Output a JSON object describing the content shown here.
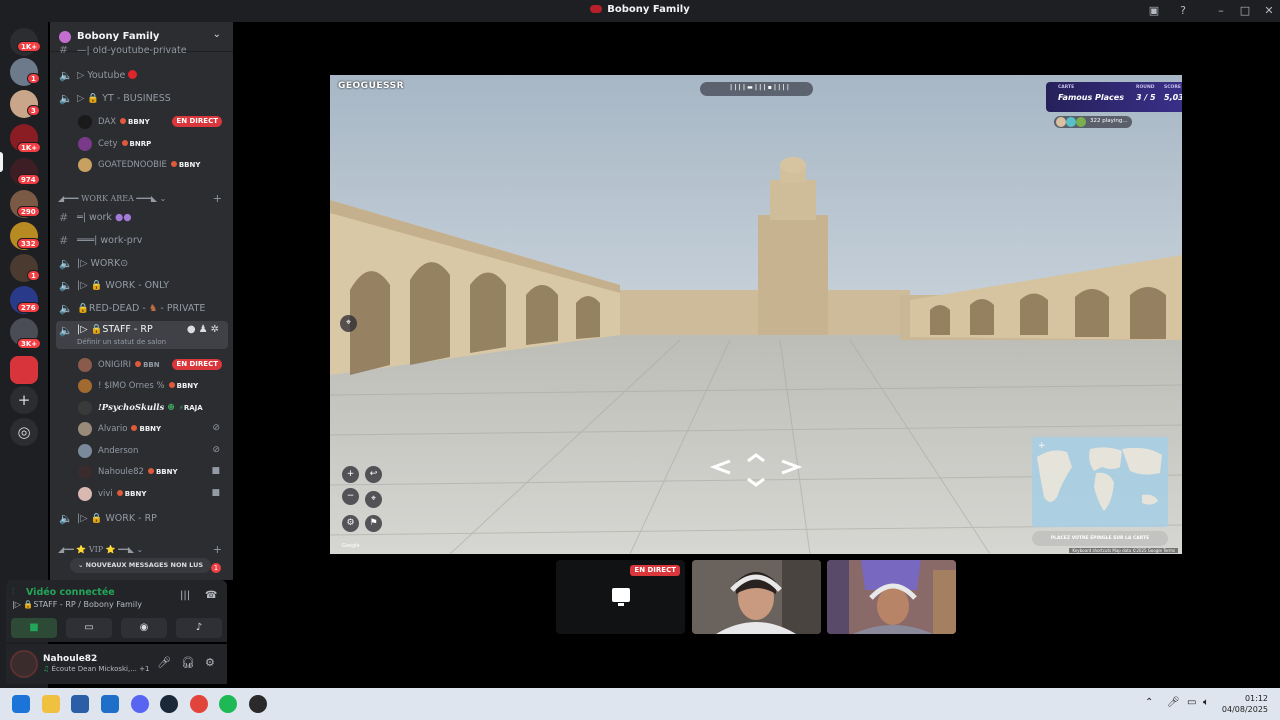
{
  "window": {
    "title": "Bobony Family"
  },
  "rail": {
    "badges": [
      "1K+",
      "1",
      "3",
      "1K+",
      "974",
      "290",
      "332",
      "1",
      "276",
      "3K+"
    ]
  },
  "guild": {
    "name": "Bobony Family"
  },
  "channels": {
    "top_cut": "—| old-youtube-private",
    "youtube": "Youtube",
    "yt_business": "YT - BUSINESS",
    "yt_users": [
      {
        "name": "DAX",
        "tag": "BBNY",
        "live": "EN DIRECT"
      },
      {
        "name": "Cety",
        "tag": "BNRP",
        "live": ""
      },
      {
        "name": "GOATEDNOOBIE",
        "tag": "BBNY",
        "live": ""
      }
    ],
    "work_area_cat": "◢━━━ WORK AREA ━━━◣",
    "work": "═| work",
    "work_prv": "═══| work-prv",
    "work_o": "WORK",
    "work_only": "WORK - ONLY",
    "red_dead": "RED-DEAD -",
    "red_dead_suffix": "- PRIVATE",
    "staff_rp": "STAFF - RP",
    "staff_rp_sub": "Définir un statut de salon",
    "staff_users": [
      {
        "name": "ONIGIRI",
        "tag": "BBN",
        "live": "EN DIRECT",
        "icon": ""
      },
      {
        "name": "! $IMO Ornes %",
        "tag": "BBNY",
        "live": "",
        "icon": ""
      },
      {
        "name": "!PsychoSkulls",
        "tag": "RAJA",
        "live": "",
        "icon": ""
      },
      {
        "name": "Alvario",
        "tag": "BBNY",
        "live": "",
        "icon": "mute"
      },
      {
        "name": "Anderson",
        "tag": "",
        "live": "",
        "icon": "mute"
      },
      {
        "name": "Nahoule82",
        "tag": "BBNY",
        "live": "",
        "icon": "camera"
      },
      {
        "name": "vivi",
        "tag": "BBNY",
        "live": "",
        "icon": "camera"
      }
    ],
    "work_rp": "WORK - RP",
    "vip_cat": "◢━━ ⭐ VIP ⭐ ━━◣",
    "new_messages": "NOUVEAUX MESSAGES NON LUS",
    "new_count": "1"
  },
  "voice": {
    "status": "Vidéo connectée",
    "location": "STAFF - RP / Bobony Family"
  },
  "user_panel": {
    "name": "Nahoule82",
    "status": "Écoute Dean Mickoski,...",
    "extra": "+1"
  },
  "game": {
    "logo": "GEOGUESSR",
    "hud": {
      "map_label": "CARTE",
      "map_value": "Famous Places",
      "round_label": "ROUND",
      "round_value": "3 / 5",
      "score_label": "SCORE",
      "score_value": "5,034"
    },
    "players_text": "322 playing...",
    "guess_button": "PLACEZ VOTRE ÉPINGLE SUR LA CARTE",
    "google": "Google",
    "map_attribution": "Keyboard shortcuts  Map data ©2025 Google  Terms"
  },
  "streams": {
    "live_label": "EN DIRECT"
  },
  "taskbar": {
    "time": "01:12",
    "date": "04/08/2025"
  }
}
